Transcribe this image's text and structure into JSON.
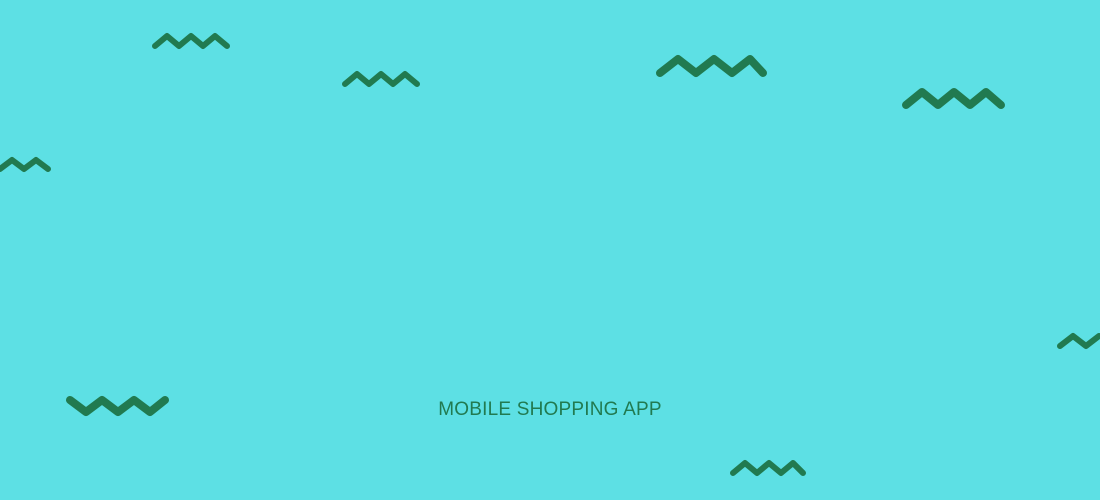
{
  "caption": "MOBILE SHOPPING APP",
  "colors": {
    "background": "#5de0e4",
    "accent": "#217a50"
  },
  "decorations": [
    "zigzag-icon",
    "zigzag-icon",
    "zigzag-icon",
    "zigzag-icon",
    "zigzag-icon",
    "zigzag-icon",
    "zigzag-icon",
    "zigzag-icon",
    "zigzag-icon"
  ]
}
